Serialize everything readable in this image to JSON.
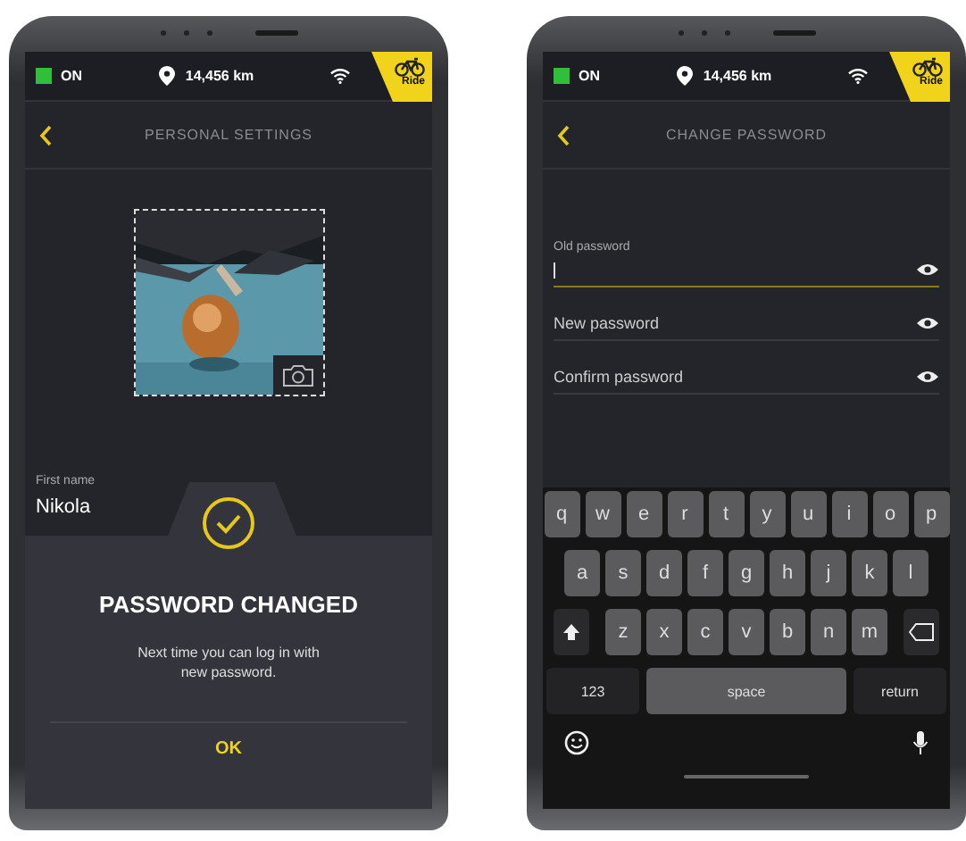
{
  "screens": [
    {
      "kind": "settings",
      "status_bar": {
        "power": "ON",
        "distance": "14,456 km",
        "mode": "Ride"
      },
      "title": "PERSONAL SETTINGS",
      "profile": {
        "field_label": "First name",
        "field_value": "Nikola"
      },
      "dialog": {
        "title": "PASSWORD CHANGED",
        "message": "Next time you can log in with new password.",
        "button": "OK"
      }
    },
    {
      "kind": "password",
      "status_bar": {
        "power": "ON",
        "distance": "14,456 km",
        "mode": "Ride"
      },
      "title": "CHANGE PASSWORD",
      "fields": [
        {
          "label": "Old password",
          "focused": true
        },
        {
          "label": "New password",
          "focused": false
        },
        {
          "label": "Confirm password",
          "focused": false
        }
      ],
      "keyboard": {
        "rows": [
          [
            "q",
            "w",
            "e",
            "r",
            "t",
            "y",
            "u",
            "i",
            "o",
            "p"
          ],
          [
            "a",
            "s",
            "d",
            "f",
            "g",
            "h",
            "j",
            "k",
            "l"
          ],
          [
            "z",
            "x",
            "c",
            "v",
            "b",
            "n",
            "m"
          ]
        ],
        "numbers_key": "123",
        "space_key": "space",
        "return_key": "return"
      }
    }
  ]
}
